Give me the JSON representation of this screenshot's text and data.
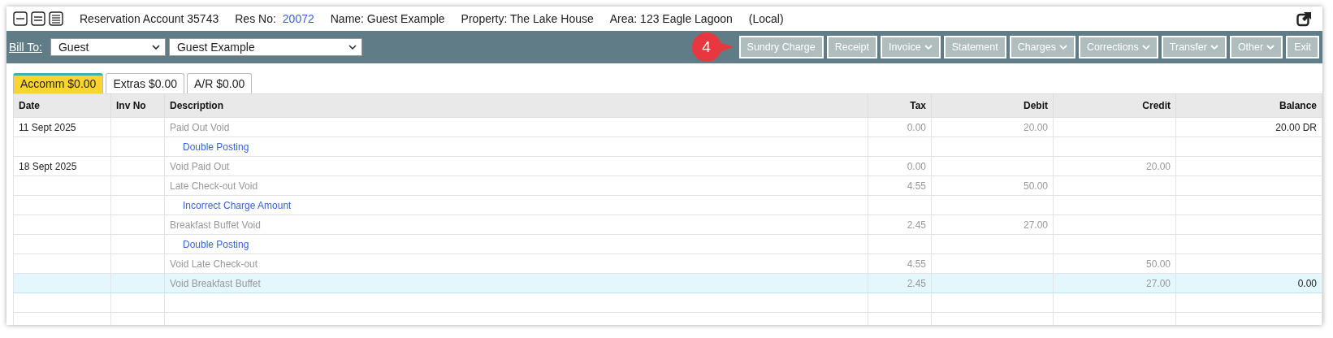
{
  "header": {
    "account": "Reservation Account 35743",
    "res_label": "Res No:",
    "res_no": "20072",
    "name": "Name: Guest Example",
    "property": "Property: The Lake House",
    "area": "Area: 123 Eagle Lagoon",
    "local": "(Local)"
  },
  "toolbar": {
    "bill_to_label": "Bill To:",
    "bill_to_type": "Guest",
    "bill_to_name": "Guest Example",
    "callout": "4",
    "buttons": [
      {
        "label": "Sundry Charge",
        "dropdown": false
      },
      {
        "label": "Receipt",
        "dropdown": false
      },
      {
        "label": "Invoice",
        "dropdown": true
      },
      {
        "label": "Statement",
        "dropdown": false
      },
      {
        "label": "Charges",
        "dropdown": true
      },
      {
        "label": "Corrections",
        "dropdown": true
      },
      {
        "label": "Transfer",
        "dropdown": true
      },
      {
        "label": "Other",
        "dropdown": true
      },
      {
        "label": "Exit",
        "dropdown": false
      }
    ]
  },
  "tabs": [
    {
      "label": "Accomm $0.00",
      "selected": true
    },
    {
      "label": "Extras $0.00",
      "selected": false
    },
    {
      "label": "A/R $0.00",
      "selected": false
    }
  ],
  "table": {
    "columns": [
      "Date",
      "Inv No",
      "Description",
      "Tax",
      "Debit",
      "Credit",
      "Balance"
    ],
    "rows": [
      {
        "kind": "entry",
        "date": "11 Sept 2025",
        "description": "Paid Out Void",
        "tax": "0.00",
        "debit": "20.00",
        "balance": "20.00 DR",
        "selected": false
      },
      {
        "kind": "reason",
        "description": "Double Posting",
        "selected": false
      },
      {
        "kind": "entry",
        "date": "18 Sept 2025",
        "description": "Void Paid Out",
        "tax": "0.00",
        "credit": "20.00",
        "selected": false
      },
      {
        "kind": "entry",
        "description": "Late Check-out Void",
        "tax": "4.55",
        "debit": "50.00",
        "selected": false
      },
      {
        "kind": "reason",
        "description": "Incorrect Charge Amount",
        "selected": false
      },
      {
        "kind": "entry",
        "description": "Breakfast Buffet Void",
        "tax": "2.45",
        "debit": "27.00",
        "selected": false
      },
      {
        "kind": "reason",
        "description": "Double Posting",
        "selected": false
      },
      {
        "kind": "entry",
        "description": "Void Late Check-out",
        "tax": "4.55",
        "credit": "50.00",
        "selected": false
      },
      {
        "kind": "entry",
        "description": "Void Breakfast Buffet",
        "tax": "2.45",
        "credit": "27.00",
        "balance": "0.00",
        "selected": true
      }
    ]
  }
}
